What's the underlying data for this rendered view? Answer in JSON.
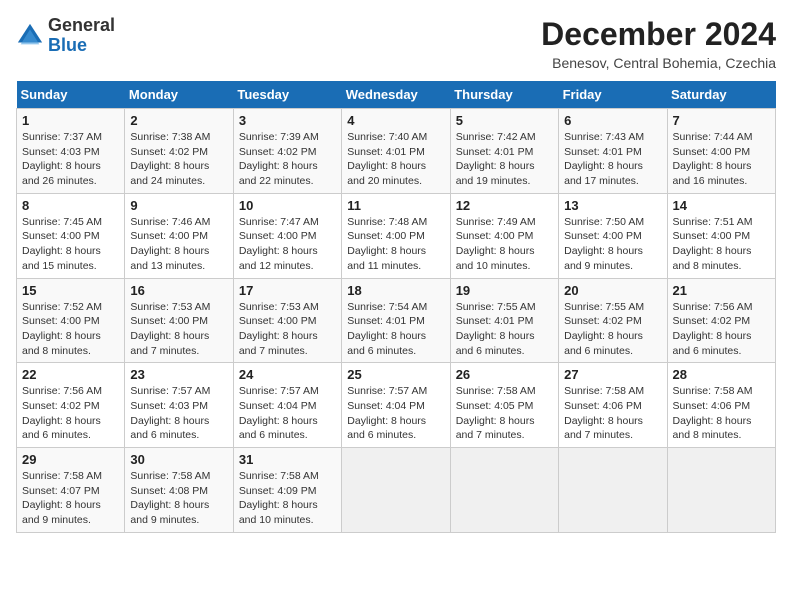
{
  "logo": {
    "general": "General",
    "blue": "Blue"
  },
  "header": {
    "title": "December 2024",
    "subtitle": "Benesov, Central Bohemia, Czechia"
  },
  "columns": [
    "Sunday",
    "Monday",
    "Tuesday",
    "Wednesday",
    "Thursday",
    "Friday",
    "Saturday"
  ],
  "weeks": [
    [
      {
        "day": "1",
        "sunrise": "7:37 AM",
        "sunset": "4:03 PM",
        "daylight": "8 hours and 26 minutes."
      },
      {
        "day": "2",
        "sunrise": "7:38 AM",
        "sunset": "4:02 PM",
        "daylight": "8 hours and 24 minutes."
      },
      {
        "day": "3",
        "sunrise": "7:39 AM",
        "sunset": "4:02 PM",
        "daylight": "8 hours and 22 minutes."
      },
      {
        "day": "4",
        "sunrise": "7:40 AM",
        "sunset": "4:01 PM",
        "daylight": "8 hours and 20 minutes."
      },
      {
        "day": "5",
        "sunrise": "7:42 AM",
        "sunset": "4:01 PM",
        "daylight": "8 hours and 19 minutes."
      },
      {
        "day": "6",
        "sunrise": "7:43 AM",
        "sunset": "4:01 PM",
        "daylight": "8 hours and 17 minutes."
      },
      {
        "day": "7",
        "sunrise": "7:44 AM",
        "sunset": "4:00 PM",
        "daylight": "8 hours and 16 minutes."
      }
    ],
    [
      {
        "day": "8",
        "sunrise": "7:45 AM",
        "sunset": "4:00 PM",
        "daylight": "8 hours and 15 minutes."
      },
      {
        "day": "9",
        "sunrise": "7:46 AM",
        "sunset": "4:00 PM",
        "daylight": "8 hours and 13 minutes."
      },
      {
        "day": "10",
        "sunrise": "7:47 AM",
        "sunset": "4:00 PM",
        "daylight": "8 hours and 12 minutes."
      },
      {
        "day": "11",
        "sunrise": "7:48 AM",
        "sunset": "4:00 PM",
        "daylight": "8 hours and 11 minutes."
      },
      {
        "day": "12",
        "sunrise": "7:49 AM",
        "sunset": "4:00 PM",
        "daylight": "8 hours and 10 minutes."
      },
      {
        "day": "13",
        "sunrise": "7:50 AM",
        "sunset": "4:00 PM",
        "daylight": "8 hours and 9 minutes."
      },
      {
        "day": "14",
        "sunrise": "7:51 AM",
        "sunset": "4:00 PM",
        "daylight": "8 hours and 8 minutes."
      }
    ],
    [
      {
        "day": "15",
        "sunrise": "7:52 AM",
        "sunset": "4:00 PM",
        "daylight": "8 hours and 8 minutes."
      },
      {
        "day": "16",
        "sunrise": "7:53 AM",
        "sunset": "4:00 PM",
        "daylight": "8 hours and 7 minutes."
      },
      {
        "day": "17",
        "sunrise": "7:53 AM",
        "sunset": "4:00 PM",
        "daylight": "8 hours and 7 minutes."
      },
      {
        "day": "18",
        "sunrise": "7:54 AM",
        "sunset": "4:01 PM",
        "daylight": "8 hours and 6 minutes."
      },
      {
        "day": "19",
        "sunrise": "7:55 AM",
        "sunset": "4:01 PM",
        "daylight": "8 hours and 6 minutes."
      },
      {
        "day": "20",
        "sunrise": "7:55 AM",
        "sunset": "4:02 PM",
        "daylight": "8 hours and 6 minutes."
      },
      {
        "day": "21",
        "sunrise": "7:56 AM",
        "sunset": "4:02 PM",
        "daylight": "8 hours and 6 minutes."
      }
    ],
    [
      {
        "day": "22",
        "sunrise": "7:56 AM",
        "sunset": "4:02 PM",
        "daylight": "8 hours and 6 minutes."
      },
      {
        "day": "23",
        "sunrise": "7:57 AM",
        "sunset": "4:03 PM",
        "daylight": "8 hours and 6 minutes."
      },
      {
        "day": "24",
        "sunrise": "7:57 AM",
        "sunset": "4:04 PM",
        "daylight": "8 hours and 6 minutes."
      },
      {
        "day": "25",
        "sunrise": "7:57 AM",
        "sunset": "4:04 PM",
        "daylight": "8 hours and 6 minutes."
      },
      {
        "day": "26",
        "sunrise": "7:58 AM",
        "sunset": "4:05 PM",
        "daylight": "8 hours and 7 minutes."
      },
      {
        "day": "27",
        "sunrise": "7:58 AM",
        "sunset": "4:06 PM",
        "daylight": "8 hours and 7 minutes."
      },
      {
        "day": "28",
        "sunrise": "7:58 AM",
        "sunset": "4:06 PM",
        "daylight": "8 hours and 8 minutes."
      }
    ],
    [
      {
        "day": "29",
        "sunrise": "7:58 AM",
        "sunset": "4:07 PM",
        "daylight": "8 hours and 9 minutes."
      },
      {
        "day": "30",
        "sunrise": "7:58 AM",
        "sunset": "4:08 PM",
        "daylight": "8 hours and 9 minutes."
      },
      {
        "day": "31",
        "sunrise": "7:58 AM",
        "sunset": "4:09 PM",
        "daylight": "8 hours and 10 minutes."
      },
      null,
      null,
      null,
      null
    ]
  ]
}
